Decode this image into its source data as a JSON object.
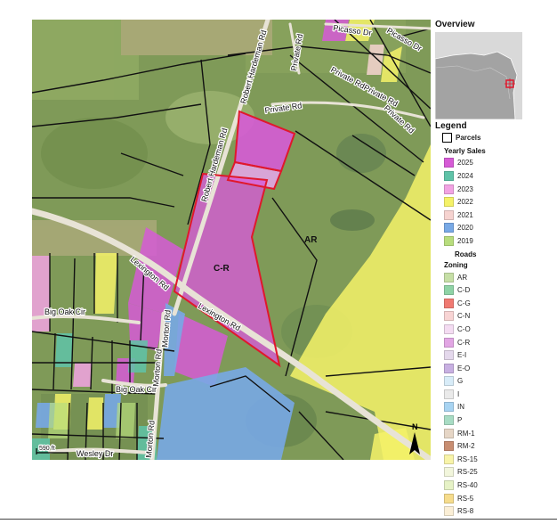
{
  "map": {
    "roads": [
      {
        "id": "robert-hardeman-rd-1",
        "label": "Robert Hardeman Rd"
      },
      {
        "id": "robert-hardeman-rd-2",
        "label": "Robert Hardeman Rd"
      },
      {
        "id": "private-rd-1",
        "label": "Private Rd"
      },
      {
        "id": "private-rd-2",
        "label": "Private Rd"
      },
      {
        "id": "private-rd-3",
        "label": "Private Rd"
      },
      {
        "id": "private-rd-4",
        "label": "Private Rd"
      },
      {
        "id": "private-rd-5",
        "label": "Private Rd"
      },
      {
        "id": "picasso-dr-1",
        "label": "Picasso Dr"
      },
      {
        "id": "picasso-dr-2",
        "label": "Picasso Dr"
      },
      {
        "id": "lexington-rd-1",
        "label": "Lexington Rd"
      },
      {
        "id": "lexington-rd-2",
        "label": "Lexington Rd"
      },
      {
        "id": "big-oak-cir-1",
        "label": "Big Oak Cir"
      },
      {
        "id": "big-oak-cir-2",
        "label": "Big Oak Cir"
      },
      {
        "id": "morton-rd-1",
        "label": "Morton Rd"
      },
      {
        "id": "morton-rd-2",
        "label": "Morton Rd"
      },
      {
        "id": "morton-rd-3",
        "label": "Morton Rd"
      },
      {
        "id": "wesley-dr",
        "label": "Wesley Dr"
      }
    ],
    "zone_labels": {
      "cr": "C-R",
      "ar": "AR"
    },
    "scale_label": "590 ft",
    "north_label": "N"
  },
  "overview": {
    "title": "Overview"
  },
  "legend": {
    "title": "Legend",
    "parcels_label": "Parcels",
    "yearly_sales_label": "Yearly Sales",
    "yearly_sales": [
      {
        "label": "2025",
        "color": "#d65bd6"
      },
      {
        "label": "2024",
        "color": "#5fc3a8"
      },
      {
        "label": "2023",
        "color": "#f2a3e3"
      },
      {
        "label": "2022",
        "color": "#f5f268"
      },
      {
        "label": "2021",
        "color": "#f6d3d0"
      },
      {
        "label": "2020",
        "color": "#78a9e6"
      },
      {
        "label": "2019",
        "color": "#b8dd7d"
      }
    ],
    "roads_label": "Roads",
    "zoning_label": "Zoning",
    "zoning": [
      {
        "label": "AR",
        "color": "#c6dfa6"
      },
      {
        "label": "C-D",
        "color": "#8fd3a6"
      },
      {
        "label": "C-G",
        "color": "#f07a72"
      },
      {
        "label": "C-N",
        "color": "#f8d4d4"
      },
      {
        "label": "C-O",
        "color": "#f4dcf2"
      },
      {
        "label": "C-R",
        "color": "#e2a6e4"
      },
      {
        "label": "E-I",
        "color": "#e4d8ec"
      },
      {
        "label": "E-O",
        "color": "#c8b0e2"
      },
      {
        "label": "G",
        "color": "#d8ecf8"
      },
      {
        "label": "I",
        "color": "#eaeaea"
      },
      {
        "label": "IN",
        "color": "#a8d4f2"
      },
      {
        "label": "P",
        "color": "#a8dcc4"
      },
      {
        "label": "RM-1",
        "color": "#e6d6c6"
      },
      {
        "label": "RM-2",
        "color": "#c88e72"
      },
      {
        "label": "RS-15",
        "color": "#f8f4a8"
      },
      {
        "label": "RS-25",
        "color": "#f2f6dc"
      },
      {
        "label": "RS-40",
        "color": "#e6f2c6"
      },
      {
        "label": "RS-5",
        "color": "#f6dc8c"
      },
      {
        "label": "RS-8",
        "color": "#fbefd6"
      }
    ]
  }
}
